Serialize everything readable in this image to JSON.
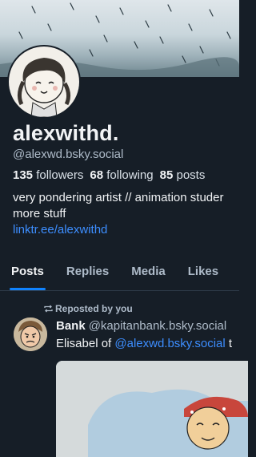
{
  "profile": {
    "display_name": "alexwithd.",
    "handle": "@alexwd.bsky.social",
    "followers_count": "135",
    "followers_label": "followers",
    "following_count": "68",
    "following_label": "following",
    "posts_count": "85",
    "posts_label": "posts",
    "bio_line1": "very pondering artist // animation studer",
    "bio_line2": "more stuff",
    "link": "linktr.ee/alexwithd"
  },
  "tabs": [
    {
      "label": "Posts",
      "active": true
    },
    {
      "label": "Replies",
      "active": false
    },
    {
      "label": "Media",
      "active": false
    },
    {
      "label": "Likes",
      "active": false
    }
  ],
  "feed": {
    "post": {
      "repost_label": "Reposted by you",
      "author_name": "Bank",
      "author_handle": "@kapitanbank.bsky.social",
      "text_prefix": "Elisabel of ",
      "mention": "@alexwd.bsky.social",
      "text_suffix": " t"
    }
  },
  "colors": {
    "background": "#161e27",
    "accent": "#1083fe",
    "link": "#3d8eff",
    "muted": "#aebbc9"
  },
  "icons": {
    "repost": "repost-icon"
  }
}
